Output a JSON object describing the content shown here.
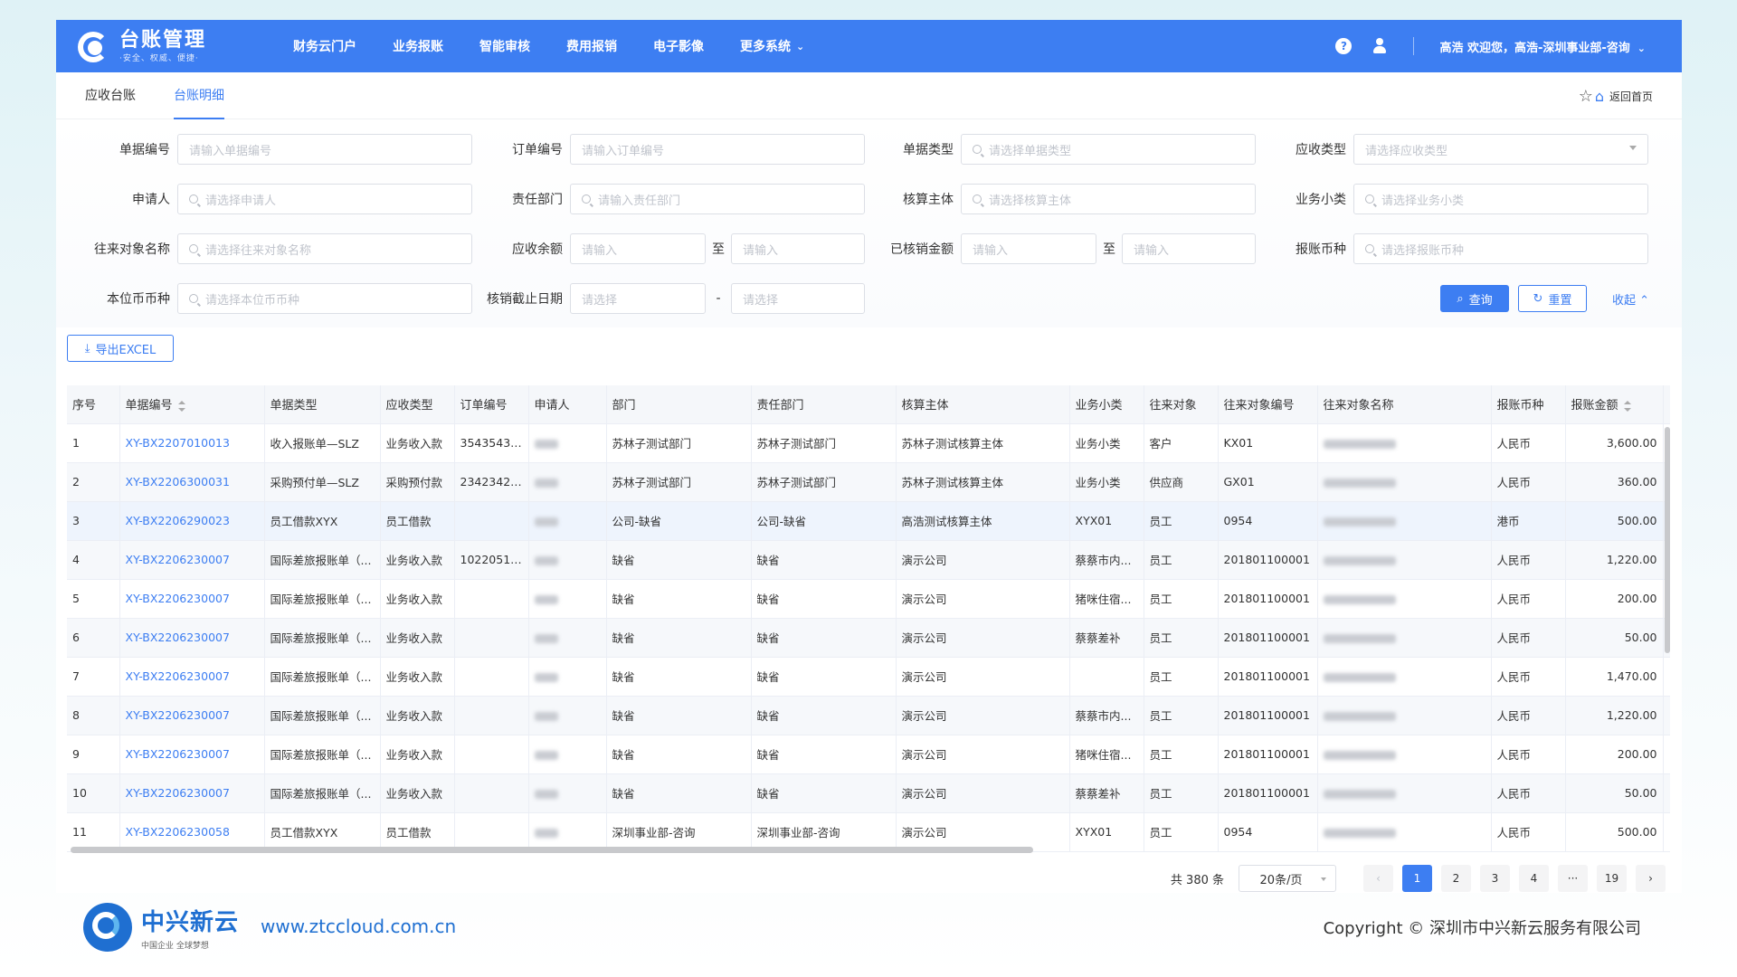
{
  "app": {
    "title": "台账管理",
    "subtitle": "·安全、权威、便捷·"
  },
  "nav": [
    {
      "label": "财务云门户"
    },
    {
      "label": "业务报账"
    },
    {
      "label": "智能审核"
    },
    {
      "label": "费用报销"
    },
    {
      "label": "电子影像"
    },
    {
      "label": "更多系统"
    }
  ],
  "header": {
    "help_glyph": "?",
    "welcome": "高浩  欢迎您，高浩-深圳事业部-咨询"
  },
  "tabs": [
    {
      "label": "应收台账"
    },
    {
      "label": "台账明细"
    }
  ],
  "home_link": "返回首页",
  "filters": {
    "doc_no": {
      "label": "单据编号",
      "placeholder": "请输入单据编号"
    },
    "order_no": {
      "label": "订单编号",
      "placeholder": "请输入订单编号"
    },
    "doc_type": {
      "label": "单据类型",
      "placeholder": "请选择单据类型"
    },
    "recv_type": {
      "label": "应收类型",
      "placeholder": "请选择应收类型"
    },
    "applicant": {
      "label": "申请人",
      "placeholder": "请选择申请人"
    },
    "resp_dept": {
      "label": "责任部门",
      "placeholder": "请输入责任部门"
    },
    "acct_entity": {
      "label": "核算主体",
      "placeholder": "请选择核算主体"
    },
    "biz_sub": {
      "label": "业务小类",
      "placeholder": "请选择业务小类"
    },
    "partner_name": {
      "label": "往来对象名称",
      "placeholder": "请选择往来对象名称"
    },
    "recv_balance": {
      "label": "应收余额",
      "placeholder_from": "请输入",
      "placeholder_to": "请输入"
    },
    "written_off": {
      "label": "已核销金额",
      "placeholder_from": "请输入",
      "placeholder_to": "请输入"
    },
    "claim_currency": {
      "label": "报账币种",
      "placeholder": "请选择报账币种"
    },
    "local_currency": {
      "label": "本位币币种",
      "placeholder": "请选择本位币币种"
    },
    "writeoff_date": {
      "label": "核销截止日期",
      "placeholder_from": "请选择",
      "placeholder_to": "请选择"
    },
    "range_sep": "至",
    "date_sep": "-"
  },
  "buttons": {
    "query": "查询",
    "reset": "重置",
    "collapse": "收起",
    "export": "导出EXCEL"
  },
  "table": {
    "columns": [
      "序号",
      "单据编号",
      "单据类型",
      "应收类型",
      "订单编号",
      "申请人",
      "部门",
      "责任部门",
      "核算主体",
      "业务小类",
      "往来对象",
      "往来对象编号",
      "往来对象名称",
      "报账币种",
      "报账金额"
    ],
    "rows": [
      [
        "1",
        "XY-BX2207010013",
        "收入报账单—SLZ",
        "业务收入款",
        "35435435...",
        "",
        "苏林子测试部门",
        "苏林子测试部门",
        "苏林子测试核算主体",
        "业务小类",
        "客户",
        "KX01",
        "",
        "人民币",
        "3,600.00"
      ],
      [
        "2",
        "XY-BX2206300031",
        "采购预付单—SLZ",
        "采购预付款",
        "23423423...",
        "",
        "苏林子测试部门",
        "苏林子测试部门",
        "苏林子测试核算主体",
        "业务小类",
        "供应商",
        "GX01",
        "",
        "人民币",
        "360.00"
      ],
      [
        "3",
        "XY-BX2206290023",
        "员工借款XYX",
        "员工借款",
        "",
        "",
        "公司-缺省",
        "公司-缺省",
        "高浩测试核算主体",
        "XYX01",
        "员工",
        "0954",
        "",
        "港币",
        "500.00"
      ],
      [
        "4",
        "XY-BX2206230007",
        "国际差旅报账单（...",
        "业务收入款",
        "10220518...",
        "",
        "缺省",
        "缺省",
        "演示公司",
        "蔡蔡市内...",
        "员工",
        "201801100001",
        "",
        "人民币",
        "1,220.00"
      ],
      [
        "5",
        "XY-BX2206230007",
        "国际差旅报账单（...",
        "业务收入款",
        "",
        "",
        "缺省",
        "缺省",
        "演示公司",
        "猪咪住宿...",
        "员工",
        "201801100001",
        "",
        "人民币",
        "200.00"
      ],
      [
        "6",
        "XY-BX2206230007",
        "国际差旅报账单（...",
        "业务收入款",
        "",
        "",
        "缺省",
        "缺省",
        "演示公司",
        "蔡蔡差补",
        "员工",
        "201801100001",
        "",
        "人民币",
        "50.00"
      ],
      [
        "7",
        "XY-BX2206230007",
        "国际差旅报账单（...",
        "业务收入款",
        "",
        "",
        "缺省",
        "缺省",
        "演示公司",
        "",
        "员工",
        "201801100001",
        "",
        "人民币",
        "1,470.00"
      ],
      [
        "8",
        "XY-BX2206230007",
        "国际差旅报账单（...",
        "业务收入款",
        "",
        "",
        "缺省",
        "缺省",
        "演示公司",
        "蔡蔡市内...",
        "员工",
        "201801100001",
        "",
        "人民币",
        "1,220.00"
      ],
      [
        "9",
        "XY-BX2206230007",
        "国际差旅报账单（...",
        "业务收入款",
        "",
        "",
        "缺省",
        "缺省",
        "演示公司",
        "猪咪住宿...",
        "员工",
        "201801100001",
        "",
        "人民币",
        "200.00"
      ],
      [
        "10",
        "XY-BX2206230007",
        "国际差旅报账单（...",
        "业务收入款",
        "",
        "",
        "缺省",
        "缺省",
        "演示公司",
        "蔡蔡差补",
        "员工",
        "201801100001",
        "",
        "人民币",
        "50.00"
      ],
      [
        "11",
        "XY-BX2206230058",
        "员工借款XYX",
        "员工借款",
        "",
        "",
        "深圳事业部-咨询",
        "深圳事业部-咨询",
        "演示公司",
        "XYX01",
        "员工",
        "0954",
        "",
        "人民币",
        "500.00"
      ]
    ]
  },
  "pagination": {
    "total": "共 380 条",
    "page_size": "20条/页",
    "pages": [
      "1",
      "2",
      "3",
      "4",
      "···",
      "19"
    ],
    "current": "1",
    "prev": "‹",
    "next": "›"
  },
  "footer": {
    "brand": "中兴新云",
    "brand_sub": "中国企业 全球梦想",
    "url": "www.ztccloud.com.cn",
    "copyright": "Copyright © 深圳市中兴新云服务有限公司"
  }
}
